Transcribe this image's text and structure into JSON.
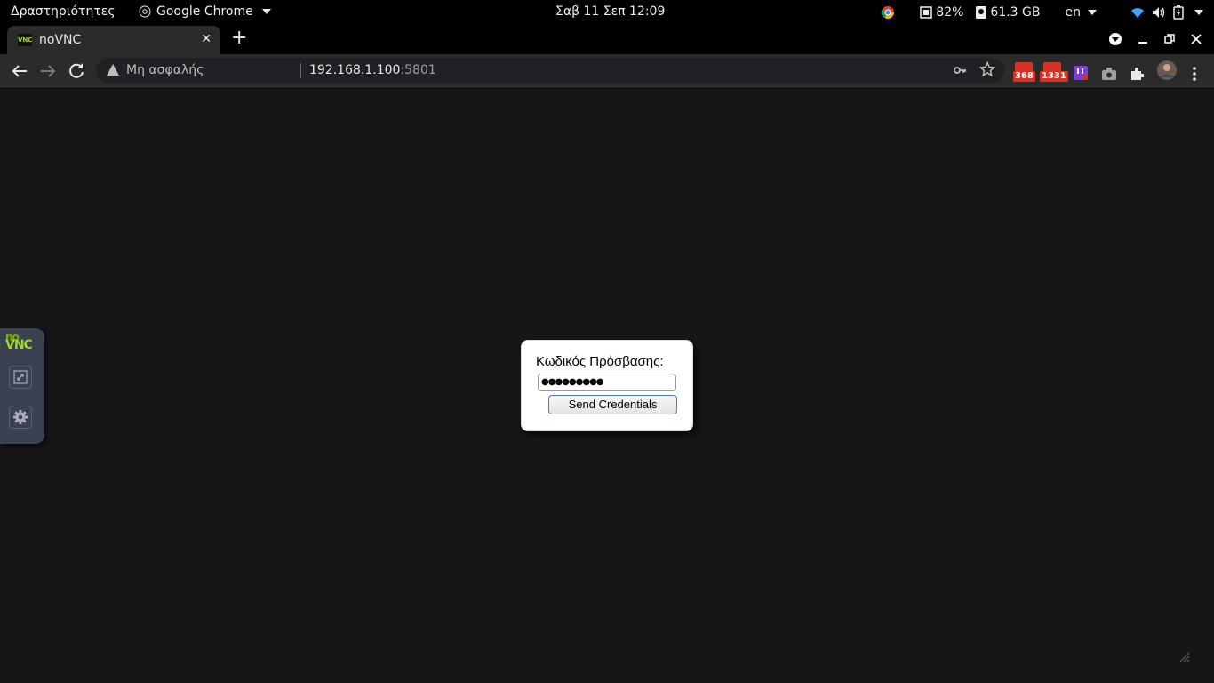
{
  "topbar": {
    "activities": "Δραστηριότητες",
    "app_name": "Google Chrome",
    "clock": "Σαβ 11 Σεπ  12:09",
    "memory": "82%",
    "disk": "61.3 GB",
    "language": "en"
  },
  "tab": {
    "title": "noVNC",
    "favicon_text": "VNC",
    "close": "✕"
  },
  "toolbar": {
    "security_label": "Μη ασφαλής",
    "url_host": "192.168.1.100",
    "url_port": ":5801",
    "ext_mail1_count": "368",
    "ext_mail2_count": "1331"
  },
  "control_bar": {
    "logo_top": "no",
    "logo_bottom": "VNC"
  },
  "dialog": {
    "label": "Κωδικός Πρόσβασης:",
    "password_value": "●●●●●●●●●",
    "button_label": "Send Credentials"
  },
  "colors": {
    "background": "#161616",
    "chrome_toolbar": "#2b2b2c",
    "novnc_green": "#9cd82d",
    "control_bar": "#3c4152",
    "badge_red": "#d93025"
  }
}
